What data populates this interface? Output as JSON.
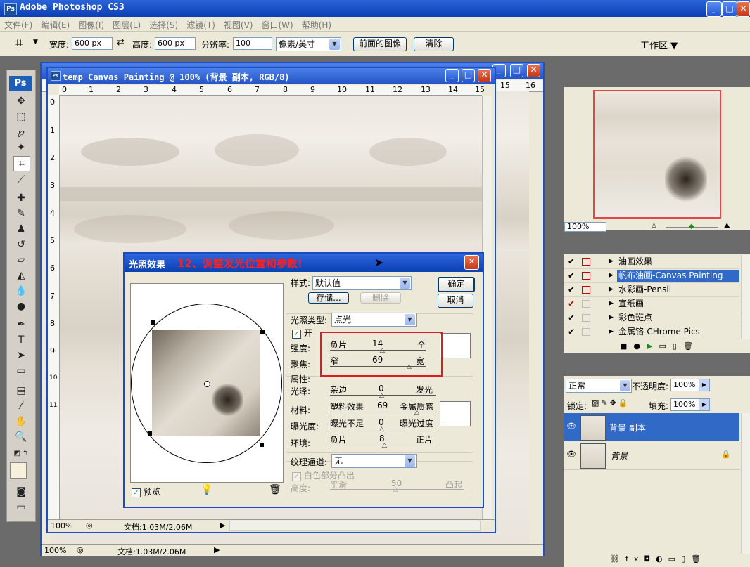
{
  "app": {
    "title": "Adobe Photoshop CS3",
    "logo": "Ps"
  },
  "menu": [
    "文件(F)",
    "编辑(E)",
    "图像(I)",
    "图层(L)",
    "选择(S)",
    "滤镜(T)",
    "视图(V)",
    "窗口(W)",
    "帮助(H)"
  ],
  "options": {
    "width_label": "宽度:",
    "width_value": "600 px",
    "height_label": "高度:",
    "height_value": "600 px",
    "resolution_label": "分辨率:",
    "resolution_value": "100",
    "unit_value": "像素/英寸",
    "front_image_button": "前面的图像",
    "clear_button": "清除",
    "workspace": "工作区 ▼"
  },
  "doc_back": {
    "zoom": "100%",
    "doc_size": "文档:1.03M/2.06M",
    "ruler_extra": [
      "15",
      "16"
    ]
  },
  "doc_front": {
    "title": "temp Canvas Painting @ 100% (背景 副本, RGB/8)",
    "zoom": "100%",
    "doc_size": "文档:1.03M/2.06M",
    "ruler_top": [
      "0",
      "1",
      "2",
      "3",
      "4",
      "5",
      "6",
      "7",
      "8",
      "9",
      "10",
      "11",
      "12",
      "13",
      "14",
      "15"
    ],
    "ruler_left": [
      "0",
      "1",
      "2",
      "3",
      "4",
      "5",
      "6",
      "7",
      "8",
      "9",
      "10",
      "11"
    ]
  },
  "dialog": {
    "title": "光照效果",
    "annotation": "12、调整发光位置和参数!",
    "style_label": "样式:",
    "style_value": "默认值",
    "save_button": "存储...",
    "delete_button": "删除",
    "ok_button": "确定",
    "cancel_button": "取消",
    "light_type_label": "光照类型:",
    "light_type_value": "点光",
    "on_label": "开",
    "intensity_label": "强度:",
    "intensity_left": "负片",
    "intensity_value": "14",
    "intensity_right": "全",
    "focus_label": "聚焦:",
    "focus_left": "窄",
    "focus_value": "69",
    "focus_right": "宽",
    "properties_label": "属性:",
    "gloss_label": "光泽:",
    "gloss_left": "杂边",
    "gloss_value": "0",
    "gloss_right": "发光",
    "material_label": "材料:",
    "material_left": "塑料效果",
    "material_value": "69",
    "material_right": "金属质感",
    "exposure_label": "曝光度:",
    "exposure_left": "曝光不足",
    "exposure_value": "0",
    "exposure_right": "曝光过度",
    "ambience_label": "环境:",
    "ambience_left": "负片",
    "ambience_value": "8",
    "ambience_right": "正片",
    "texture_label": "纹理通道:",
    "texture_value": "无",
    "white_high_label": "白色部分凸出",
    "height_label": "高度:",
    "height_left": "平滑",
    "height_value": "50",
    "height_right": "凸起",
    "preview_label": "预览",
    "accent_color": "#ff2020"
  },
  "navigator": {
    "zoom": "100%"
  },
  "actions": [
    {
      "label": "油画效果"
    },
    {
      "label": "帆布油画-Canvas Painting"
    },
    {
      "label": "水彩画-Pensil"
    },
    {
      "label": "宣纸画"
    },
    {
      "label": "彩色斑点"
    },
    {
      "label": "金属铬-CHrome Pics"
    }
  ],
  "layers": {
    "blend_mode": "正常",
    "opacity_label": "不透明度:",
    "opacity_value": "100%",
    "lock_label": "锁定:",
    "fill_label": "填充:",
    "fill_value": "100%",
    "items": [
      {
        "name": "背景 副本"
      },
      {
        "name": "背景"
      }
    ]
  }
}
